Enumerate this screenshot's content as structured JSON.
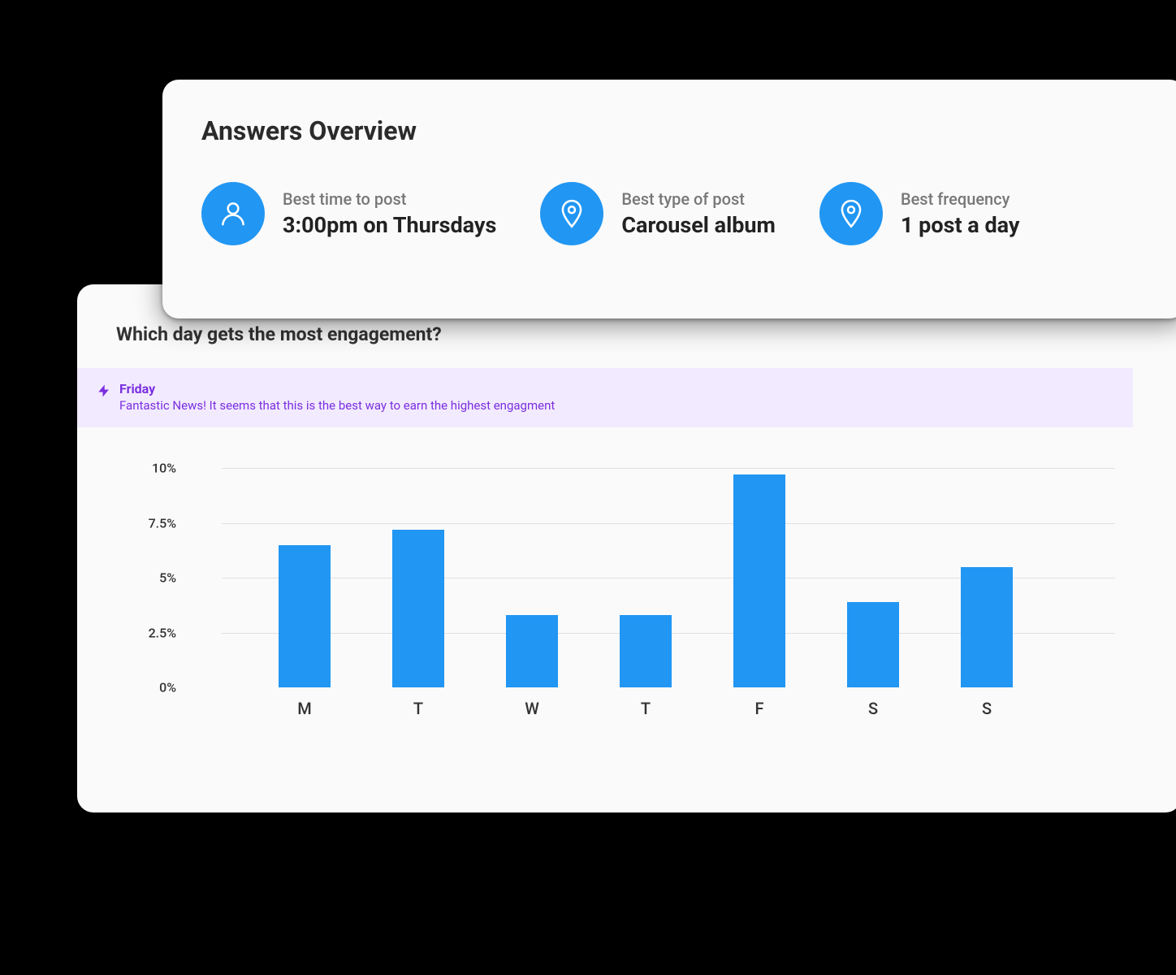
{
  "overview": {
    "title": "Answers Overview",
    "stats": [
      {
        "label": "Best time to post",
        "value": "3:00pm on Thursdays",
        "icon": "person"
      },
      {
        "label": "Best type of post",
        "value": "Carousel album",
        "icon": "pin"
      },
      {
        "label": "Best frequency",
        "value": "1 post a day",
        "icon": "pin"
      }
    ]
  },
  "chart": {
    "title": "Which day gets the most engagement?",
    "highlight": {
      "day": "Friday",
      "description": "Fantastic News! It seems that this is the best way to earn the highest engagment"
    },
    "y_ticks": [
      "0%",
      "2.5%",
      "5%",
      "7.5%",
      "10%"
    ]
  },
  "chart_data": {
    "type": "bar",
    "title": "Which day gets the most engagement?",
    "xlabel": "",
    "ylabel": "",
    "ylim": [
      0,
      10
    ],
    "categories": [
      "M",
      "T",
      "W",
      "T",
      "F",
      "S",
      "S"
    ],
    "values": [
      6.5,
      7.2,
      3.3,
      3.3,
      9.7,
      3.9,
      5.5
    ]
  },
  "colors": {
    "accent": "#2196f3",
    "highlight_bg": "#f2ebff",
    "highlight_fg": "#7b2fe0"
  }
}
